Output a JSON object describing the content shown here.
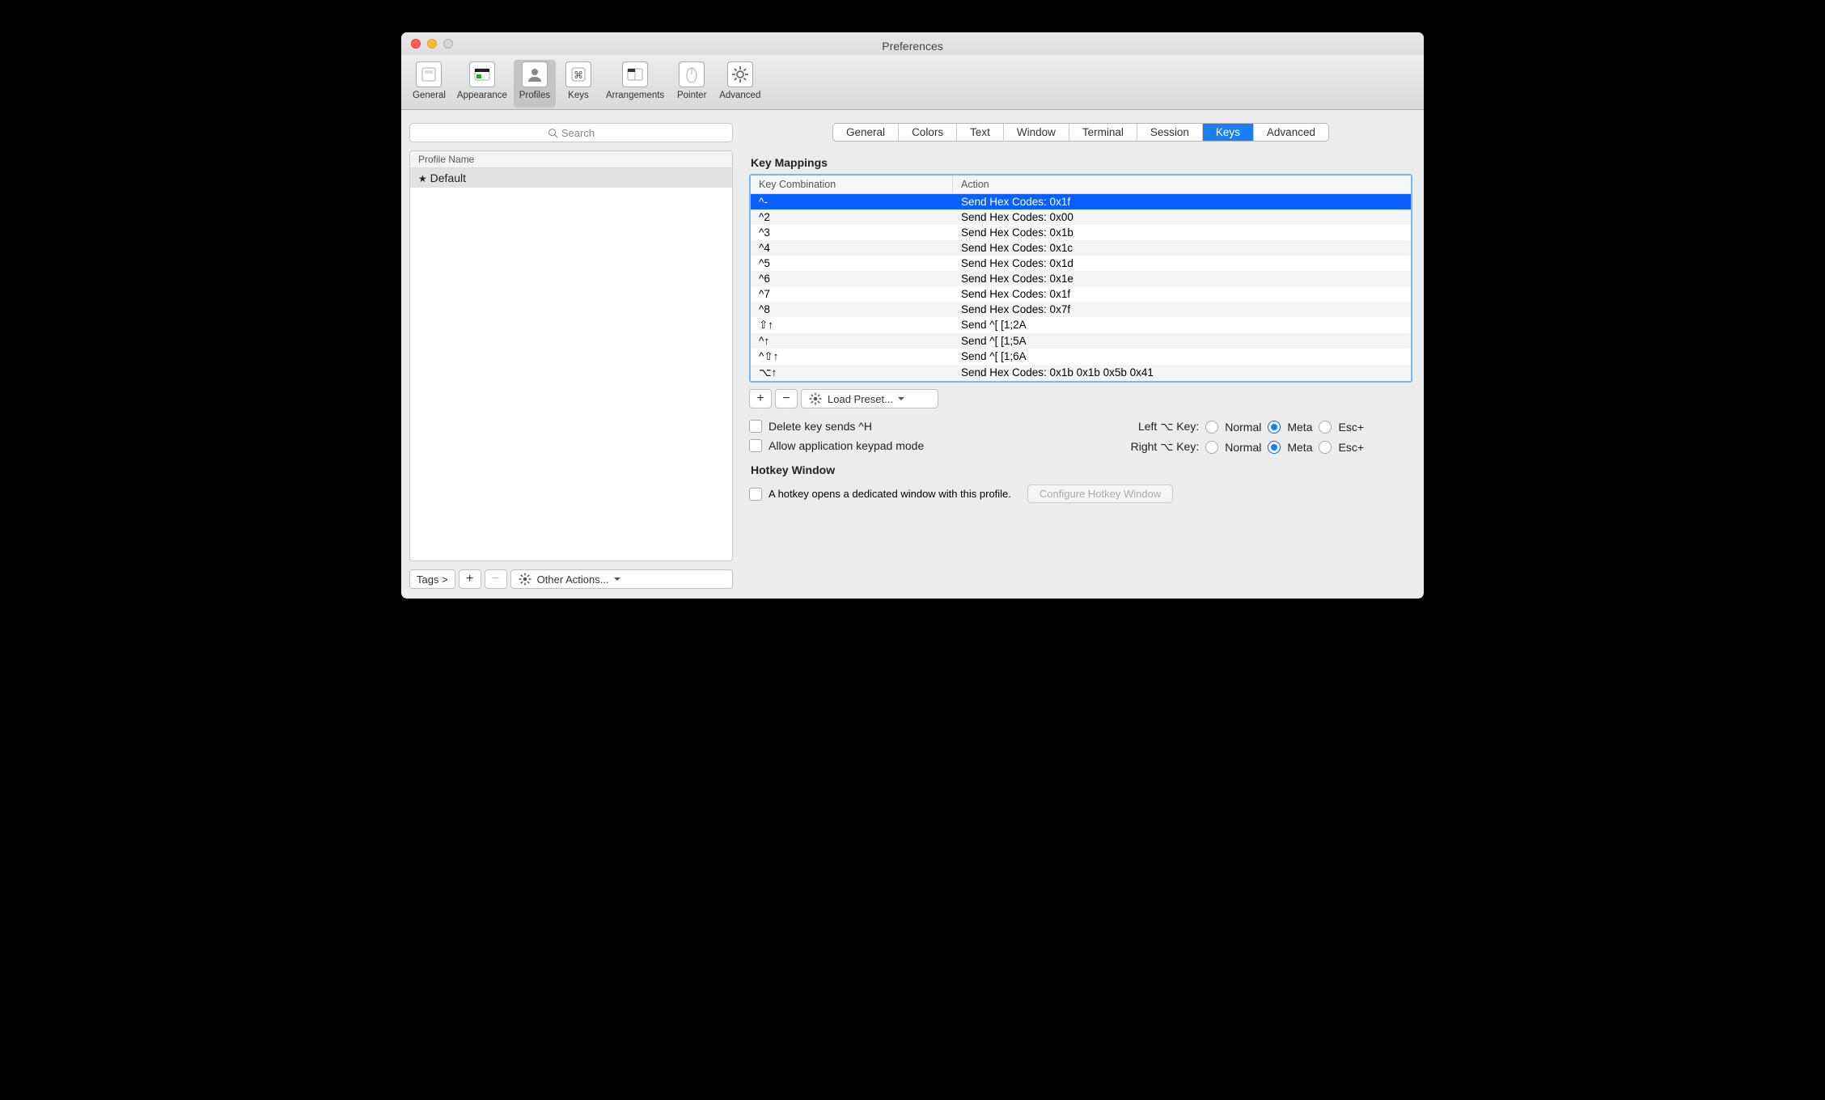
{
  "window": {
    "title": "Preferences"
  },
  "toolbar": {
    "items": [
      {
        "label": "General"
      },
      {
        "label": "Appearance"
      },
      {
        "label": "Profiles"
      },
      {
        "label": "Keys"
      },
      {
        "label": "Arrangements"
      },
      {
        "label": "Pointer"
      },
      {
        "label": "Advanced"
      }
    ],
    "selected": "Profiles"
  },
  "sidebar": {
    "search_placeholder": "Search",
    "header": "Profile Name",
    "profiles": [
      {
        "label": "Default",
        "starred": true
      }
    ],
    "tags_label": "Tags >",
    "other_actions_label": "Other Actions..."
  },
  "subtabs": {
    "items": [
      "General",
      "Colors",
      "Text",
      "Window",
      "Terminal",
      "Session",
      "Keys",
      "Advanced"
    ],
    "active": "Keys"
  },
  "key_mappings": {
    "title": "Key Mappings",
    "headers": {
      "combo": "Key Combination",
      "action": "Action"
    },
    "rows": [
      {
        "combo": "^-",
        "action": "Send Hex Codes: 0x1f",
        "selected": true
      },
      {
        "combo": "^2",
        "action": "Send Hex Codes: 0x00"
      },
      {
        "combo": "^3",
        "action": "Send Hex Codes: 0x1b"
      },
      {
        "combo": "^4",
        "action": "Send Hex Codes: 0x1c"
      },
      {
        "combo": "^5",
        "action": "Send Hex Codes: 0x1d"
      },
      {
        "combo": "^6",
        "action": "Send Hex Codes: 0x1e"
      },
      {
        "combo": "^7",
        "action": "Send Hex Codes: 0x1f"
      },
      {
        "combo": "^8",
        "action": "Send Hex Codes: 0x7f"
      },
      {
        "combo": "⇧↑",
        "action": "Send ^[ [1;2A"
      },
      {
        "combo": "^↑",
        "action": "Send ^[ [1;5A"
      },
      {
        "combo": "^⇧↑",
        "action": "Send ^[ [1;6A"
      },
      {
        "combo": "⌥↑",
        "action": "Send Hex Codes: 0x1b 0x1b 0x5b 0x41"
      }
    ],
    "preset_label": "Load Preset..."
  },
  "options": {
    "delete_sends_label": "Delete key sends ^H",
    "allow_keypad_label": "Allow application keypad mode",
    "left_opt_label": "Left ⌥ Key:",
    "right_opt_label": "Right ⌥ Key:",
    "normal_label": "Normal",
    "meta_label": "Meta",
    "esc_label": "Esc+",
    "left_opt_value": "Meta",
    "right_opt_value": "Meta"
  },
  "hotkey": {
    "title": "Hotkey Window",
    "checkbox_label": "A hotkey opens a dedicated window with this profile.",
    "button_label": "Configure Hotkey Window"
  }
}
